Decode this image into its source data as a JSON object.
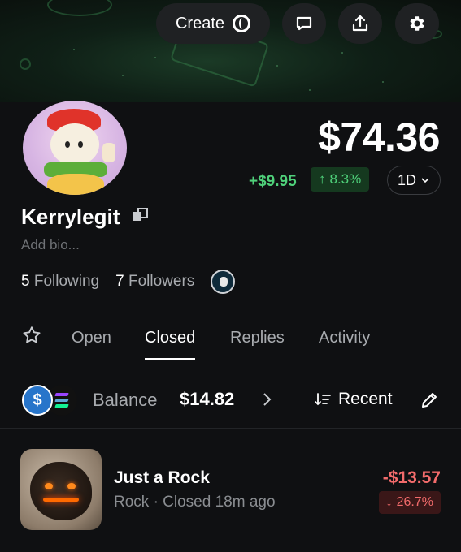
{
  "header": {
    "create_label": "Create",
    "icons": [
      "comment-icon",
      "share-icon",
      "settings-icon"
    ]
  },
  "profile": {
    "price": "$74.36",
    "change_abs": "+$9.95",
    "change_pct": "8.3%",
    "range": "1D",
    "username": "Kerrylegit",
    "bio": "Add bio...",
    "following_count": "5",
    "following_label": "Following",
    "followers_count": "7",
    "followers_label": "Followers"
  },
  "tabs": [
    {
      "label": "Open",
      "active": false
    },
    {
      "label": "Closed",
      "active": true
    },
    {
      "label": "Replies",
      "active": false
    },
    {
      "label": "Activity",
      "active": false
    }
  ],
  "balance": {
    "label": "Balance",
    "value": "$14.82",
    "sort_label": "Recent"
  },
  "positions": [
    {
      "title": "Just a Rock",
      "subtitle": "Rock · Closed 18m ago",
      "amount": "-$13.57",
      "pct": "26.7%"
    }
  ],
  "colors": {
    "positive": "#4fd07a",
    "negative": "#f26b6b",
    "background": "#0f1012",
    "usdc": "#2775ca"
  }
}
